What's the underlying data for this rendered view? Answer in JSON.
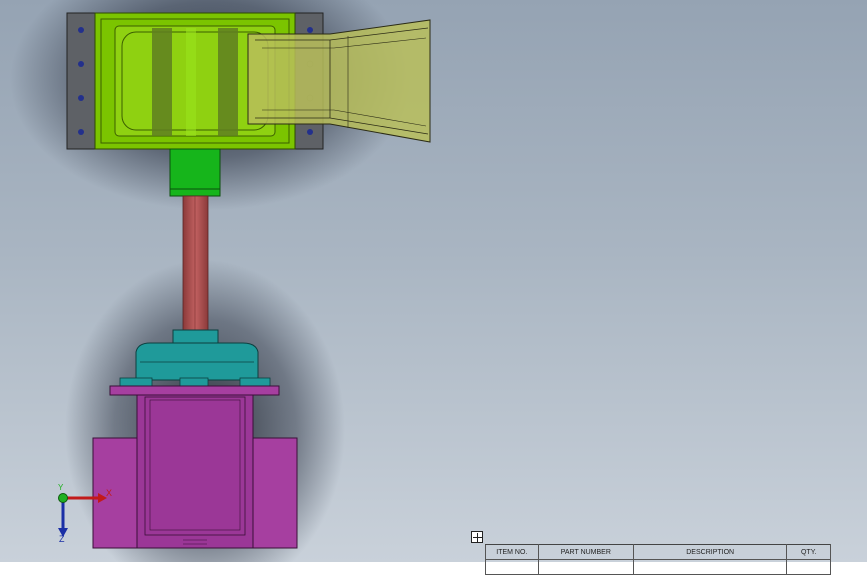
{
  "bom_table": {
    "headers": [
      "ITEM NO.",
      "PART NUMBER",
      "DESCRIPTION",
      "QTY."
    ]
  },
  "triad": {
    "x_label": "X",
    "y_label": "Y",
    "z_label": "Z"
  },
  "colors": {
    "housing_green": "#7bc400",
    "body_yellow": "#b9be5a",
    "coupling_green": "#16b51b",
    "shaft_red": "#b24d4d",
    "gearbox_teal": "#1f9a9a",
    "base_magenta": "#a63fa0",
    "background_top": "#95a3b3",
    "background_bottom": "#c9d1da"
  }
}
